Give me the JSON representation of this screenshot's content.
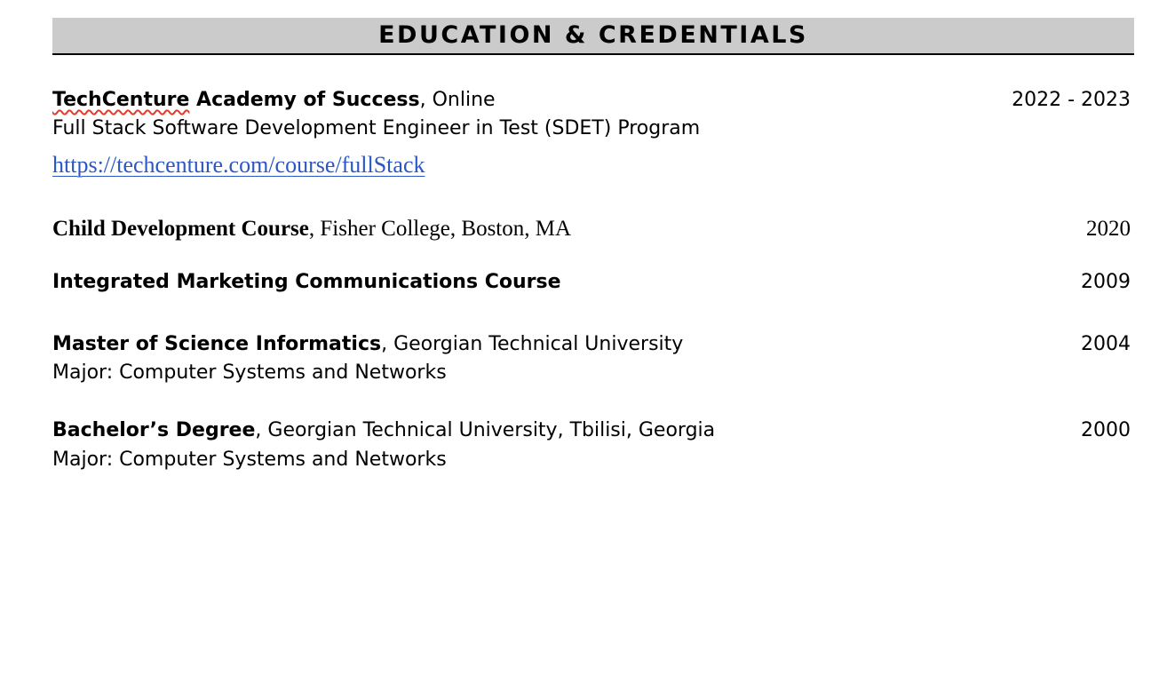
{
  "section": {
    "title": "EDUCATION & CREDENTIALS"
  },
  "entries": [
    {
      "name": "TechCenture",
      "name_rest": " Academy of Success",
      "detail": ", Online",
      "line2": "Full Stack Software Development Engineer in Test (SDET) Program",
      "link": "https://techcenture.com/course/fullStack",
      "date": "2022 - 2023"
    },
    {
      "name": "Child Development Course",
      "detail": ", Fisher College, Boston, MA",
      "date": "2020"
    },
    {
      "name": "Integrated Marketing Communications Course",
      "date": "2009"
    },
    {
      "name": "Master of Science Informatics",
      "detail": ", Georgian Technical University",
      "line2": "Major: Computer Systems and Networks",
      "date": "2004"
    },
    {
      "name": "Bachelor’s Degree",
      "detail": ", Georgian Technical University, Tbilisi, Georgia",
      "line2": "Major: Computer Systems and Networks",
      "date": "2000"
    }
  ],
  "colors": {
    "header_band": "#cbcbcb",
    "link": "#2a56c6",
    "spellcheck_underline": "#e03c2c"
  }
}
